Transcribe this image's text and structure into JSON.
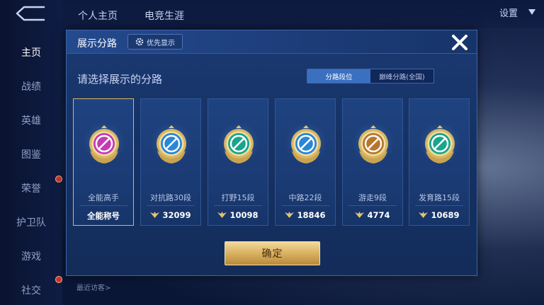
{
  "sidebar": {
    "items": [
      {
        "label": "主页"
      },
      {
        "label": "战绩"
      },
      {
        "label": "英雄"
      },
      {
        "label": "图鉴"
      },
      {
        "label": "荣誉"
      },
      {
        "label": "护卫队"
      },
      {
        "label": "游戏"
      },
      {
        "label": "社交"
      }
    ]
  },
  "topbar": {
    "tabs": [
      "个人主页",
      "电竞生涯"
    ],
    "settings_label": "设置"
  },
  "bottom": {
    "recent_visitors": "最近访客>"
  },
  "modal": {
    "title": "展示分路",
    "priority_button": "优先显示",
    "subtitle": "请选择展示的分路",
    "tabs": [
      "分路段位",
      "巅峰分路(全国)"
    ],
    "confirm_button": "确定"
  },
  "cards": [
    {
      "role": "全能高手",
      "score": "全能称号",
      "badge_color": "#c53bb6",
      "icon": "allround-badge-icon",
      "selected": true
    },
    {
      "role": "对抗路30段",
      "score": "32099",
      "badge_color": "#2a86d6",
      "icon": "clash-lane-badge-icon",
      "selected": false
    },
    {
      "role": "打野15段",
      "score": "10098",
      "badge_color": "#19a58c",
      "icon": "jungle-badge-icon",
      "selected": false
    },
    {
      "role": "中路22段",
      "score": "18846",
      "badge_color": "#2a86d6",
      "icon": "mid-lane-badge-icon",
      "selected": false
    },
    {
      "role": "游走9段",
      "score": "4774",
      "badge_color": "#b6772c",
      "icon": "roam-badge-icon",
      "selected": false
    },
    {
      "role": "发育路15段",
      "score": "10689",
      "badge_color": "#19a58c",
      "icon": "farm-lane-badge-icon",
      "selected": false
    }
  ],
  "colors": {
    "accent": "#3b70c0",
    "gold": "#d9b46a"
  }
}
